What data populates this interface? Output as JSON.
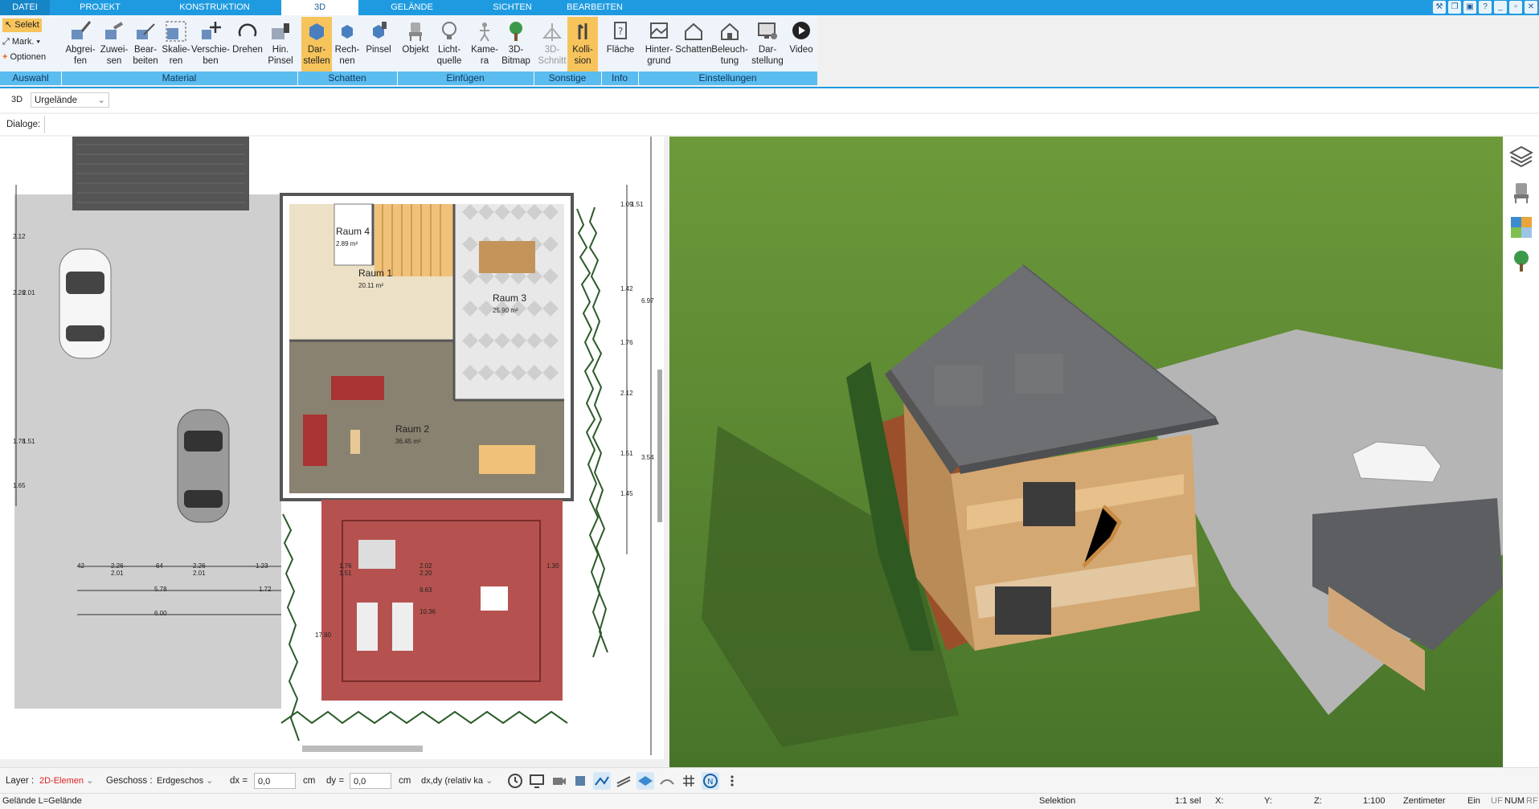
{
  "menu": {
    "tabs": [
      "DATEI",
      "PROJEKT",
      "KONSTRUKTION",
      "3D",
      "GELÄNDE",
      "SICHTEN",
      "BEARBEITEN"
    ],
    "active": "3D"
  },
  "ribbon": {
    "small": {
      "select": "Selekt",
      "mark": "Mark.",
      "options": "Optionen"
    },
    "buttons": {
      "abgreifen": "Abgrei-\nfen",
      "zuweisen": "Zuwei-\nsen",
      "bearbeiten": "Bear-\nbeiten",
      "skalieren": "Skalie-\nren",
      "verschieben": "Verschie-\nben",
      "drehen": "Drehen",
      "hinpinsel": "Hin.\nPinsel",
      "darstellen": "Dar-\nstellen",
      "rechnen": "Rech-\nnen",
      "pinsel": "Pinsel",
      "objekt": "Objekt",
      "lichtquelle": "Licht-\nquelle",
      "kamera": "Kame-\nra",
      "bitmap": "3D-\nBitmap",
      "schnitt": "3D-\nSchnitt",
      "kollision": "Kolli-\nsion",
      "flaeche": "Fläche",
      "hintergrund": "Hinter-\ngrund",
      "schatten": "Schatten",
      "beleuchtung": "Beleuch-\ntung",
      "darstellung": "Dar-\nstellung",
      "video": "Video"
    },
    "groups": [
      "Auswahl",
      "Material",
      "Schatten",
      "Einfügen",
      "Sonstige",
      "Info",
      "Einstellungen"
    ]
  },
  "toolrow": {
    "mode": "3D",
    "select_value": "Urgelände"
  },
  "dialog_label": "Dialoge:",
  "plan": {
    "rooms": [
      {
        "name": "Raum 4",
        "area": "2.89 m²"
      },
      {
        "name": "Raum 1",
        "area": "20.11 m²"
      },
      {
        "name": "Raum 3",
        "area": "25.90 m²"
      },
      {
        "name": "Raum 2",
        "area": "36.45 m²"
      }
    ],
    "dims": [
      "2.26",
      "2.01",
      "64",
      "2.26",
      "2.01",
      "42",
      "1.23",
      "1.72",
      "6.00",
      "5.78",
      "1.76",
      "1.51",
      "2.02",
      "2.20",
      "9.63",
      "10.36",
      "17.60",
      "1.30",
      "1.09",
      "1.51",
      "1.42",
      "6.97",
      "1.76",
      "2.12",
      "1.51",
      "1.45",
      "3.54",
      "2.12",
      "2.26",
      "2.01",
      "1.78",
      "1.51",
      "1.65"
    ]
  },
  "status": {
    "layer_label": "Layer :",
    "layer_value": "2D-Elemen",
    "geschoss_label": "Geschoss :",
    "geschoss_value": "Erdgeschos",
    "dx_label": "dx =",
    "dx_value": "0,0",
    "dx_unit": "cm",
    "dy_label": "dy =",
    "dy_value": "0,0",
    "dy_unit": "cm",
    "mode_value": "dx,dy (relativ ka"
  },
  "bottom": {
    "left": "Gelände L=Gelände",
    "selektion": "Selektion",
    "ratio": "1:1 sel",
    "x": "X:",
    "y": "Y:",
    "z": "Z:",
    "scale": "1:100",
    "unit": "Zentimeter",
    "ein": "Ein",
    "uf": "UF",
    "num": "NUM",
    "rf": "RF"
  },
  "colors": {
    "accent": "#1e9be0",
    "group": "#5bbcef",
    "selected": "#f7c45c",
    "grass": "#5a8a30",
    "roof": "#6d6f72",
    "patio": "#b5524f"
  }
}
